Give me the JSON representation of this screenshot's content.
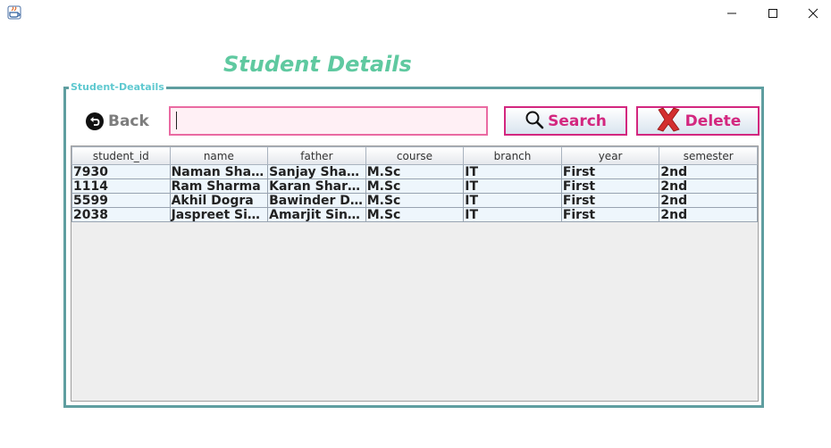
{
  "window": {
    "app_icon": "java-icon",
    "controls": {
      "minimize": "minimize-icon",
      "maximize": "maximize-icon",
      "close": "close-icon"
    }
  },
  "page_title": "Student Details",
  "panel": {
    "legend": "Student-Deatails"
  },
  "toolbar": {
    "back_label": "Back",
    "search_value": "",
    "search_label": "Search",
    "delete_label": "Delete"
  },
  "colors": {
    "title": "#5fc9a0",
    "panel_border": "#5f9ea0",
    "accent": "#d3277f",
    "input_border": "#ea6aa2",
    "input_bg": "#fff0f5",
    "delete_icon": "#d32f2f"
  },
  "table": {
    "columns": [
      "student_id",
      "name",
      "father",
      "course",
      "branch",
      "year",
      "semester"
    ],
    "rows": [
      [
        "7930",
        "Naman Sharma",
        "Sanjay Sharma",
        "M.Sc",
        "IT",
        "First",
        "2nd"
      ],
      [
        "1114",
        "Ram Sharma",
        "Karan Sharma",
        "M.Sc",
        "IT",
        "First",
        "2nd"
      ],
      [
        "5599",
        "Akhil Dogra",
        "Bawinder Dogra",
        "M.Sc",
        "IT",
        "First",
        "2nd"
      ],
      [
        "2038",
        "Jaspreet Singh",
        "Amarjit Singh",
        "M.Sc",
        "IT",
        "First",
        "2nd"
      ]
    ]
  }
}
